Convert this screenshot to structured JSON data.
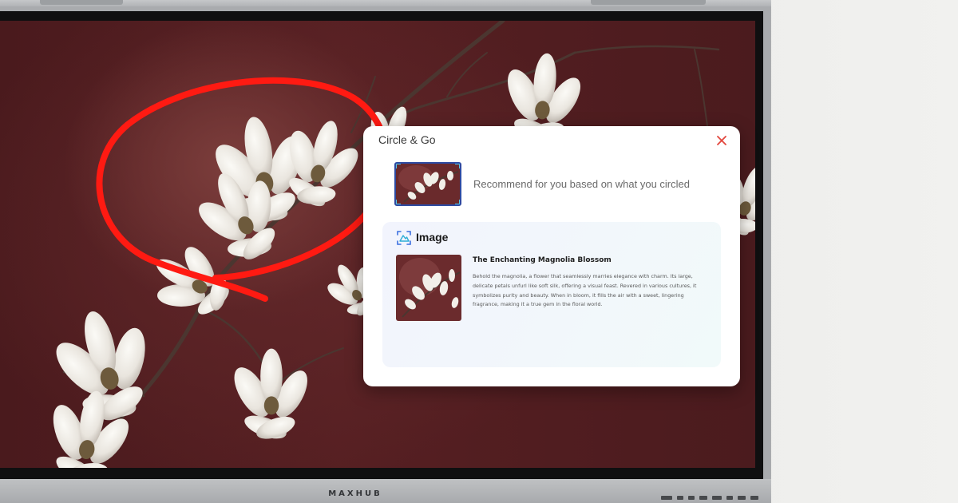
{
  "device": {
    "brand": "MAXHUB"
  },
  "popup": {
    "title": "Circle & Go",
    "recommend_text": "Recommend for you based on what you circled",
    "section_label": "Image",
    "result": {
      "title": "The Enchanting Magnolia Blossom",
      "description": "Behold the magnolia, a flower that seamlessly marries elegance with charm. Its large, delicate petals unfurl like soft silk, offering a visual feast. Revered in various cultures, it symbolizes purity and beauty. When in bloom, it fills the air with a sweet, lingering fragrance, making it a true gem in the floral world."
    },
    "icons": {
      "close": "close-icon",
      "section": "image-scan-icon"
    }
  },
  "colors": {
    "circle_annotation": "#ff1a12",
    "close_icon": "#e2453c",
    "wallpaper": "#561f22",
    "accent_icon": "#3b6fe0"
  }
}
